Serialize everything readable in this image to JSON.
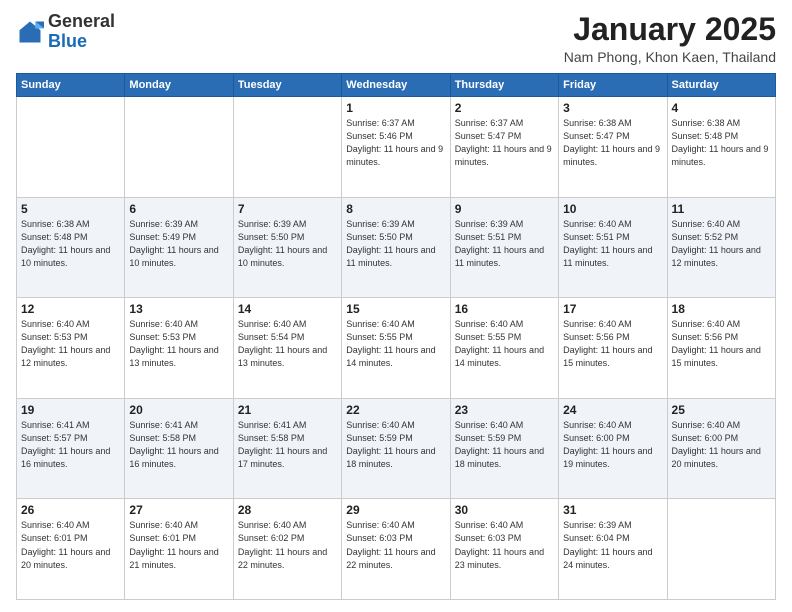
{
  "header": {
    "logo_general": "General",
    "logo_blue": "Blue",
    "month_title": "January 2025",
    "location": "Nam Phong, Khon Kaen, Thailand"
  },
  "days_of_week": [
    "Sunday",
    "Monday",
    "Tuesday",
    "Wednesday",
    "Thursday",
    "Friday",
    "Saturday"
  ],
  "weeks": [
    [
      {
        "day": "",
        "info": ""
      },
      {
        "day": "",
        "info": ""
      },
      {
        "day": "",
        "info": ""
      },
      {
        "day": "1",
        "info": "Sunrise: 6:37 AM\nSunset: 5:46 PM\nDaylight: 11 hours and 9 minutes."
      },
      {
        "day": "2",
        "info": "Sunrise: 6:37 AM\nSunset: 5:47 PM\nDaylight: 11 hours and 9 minutes."
      },
      {
        "day": "3",
        "info": "Sunrise: 6:38 AM\nSunset: 5:47 PM\nDaylight: 11 hours and 9 minutes."
      },
      {
        "day": "4",
        "info": "Sunrise: 6:38 AM\nSunset: 5:48 PM\nDaylight: 11 hours and 9 minutes."
      }
    ],
    [
      {
        "day": "5",
        "info": "Sunrise: 6:38 AM\nSunset: 5:48 PM\nDaylight: 11 hours and 10 minutes."
      },
      {
        "day": "6",
        "info": "Sunrise: 6:39 AM\nSunset: 5:49 PM\nDaylight: 11 hours and 10 minutes."
      },
      {
        "day": "7",
        "info": "Sunrise: 6:39 AM\nSunset: 5:50 PM\nDaylight: 11 hours and 10 minutes."
      },
      {
        "day": "8",
        "info": "Sunrise: 6:39 AM\nSunset: 5:50 PM\nDaylight: 11 hours and 11 minutes."
      },
      {
        "day": "9",
        "info": "Sunrise: 6:39 AM\nSunset: 5:51 PM\nDaylight: 11 hours and 11 minutes."
      },
      {
        "day": "10",
        "info": "Sunrise: 6:40 AM\nSunset: 5:51 PM\nDaylight: 11 hours and 11 minutes."
      },
      {
        "day": "11",
        "info": "Sunrise: 6:40 AM\nSunset: 5:52 PM\nDaylight: 11 hours and 12 minutes."
      }
    ],
    [
      {
        "day": "12",
        "info": "Sunrise: 6:40 AM\nSunset: 5:53 PM\nDaylight: 11 hours and 12 minutes."
      },
      {
        "day": "13",
        "info": "Sunrise: 6:40 AM\nSunset: 5:53 PM\nDaylight: 11 hours and 13 minutes."
      },
      {
        "day": "14",
        "info": "Sunrise: 6:40 AM\nSunset: 5:54 PM\nDaylight: 11 hours and 13 minutes."
      },
      {
        "day": "15",
        "info": "Sunrise: 6:40 AM\nSunset: 5:55 PM\nDaylight: 11 hours and 14 minutes."
      },
      {
        "day": "16",
        "info": "Sunrise: 6:40 AM\nSunset: 5:55 PM\nDaylight: 11 hours and 14 minutes."
      },
      {
        "day": "17",
        "info": "Sunrise: 6:40 AM\nSunset: 5:56 PM\nDaylight: 11 hours and 15 minutes."
      },
      {
        "day": "18",
        "info": "Sunrise: 6:40 AM\nSunset: 5:56 PM\nDaylight: 11 hours and 15 minutes."
      }
    ],
    [
      {
        "day": "19",
        "info": "Sunrise: 6:41 AM\nSunset: 5:57 PM\nDaylight: 11 hours and 16 minutes."
      },
      {
        "day": "20",
        "info": "Sunrise: 6:41 AM\nSunset: 5:58 PM\nDaylight: 11 hours and 16 minutes."
      },
      {
        "day": "21",
        "info": "Sunrise: 6:41 AM\nSunset: 5:58 PM\nDaylight: 11 hours and 17 minutes."
      },
      {
        "day": "22",
        "info": "Sunrise: 6:40 AM\nSunset: 5:59 PM\nDaylight: 11 hours and 18 minutes."
      },
      {
        "day": "23",
        "info": "Sunrise: 6:40 AM\nSunset: 5:59 PM\nDaylight: 11 hours and 18 minutes."
      },
      {
        "day": "24",
        "info": "Sunrise: 6:40 AM\nSunset: 6:00 PM\nDaylight: 11 hours and 19 minutes."
      },
      {
        "day": "25",
        "info": "Sunrise: 6:40 AM\nSunset: 6:00 PM\nDaylight: 11 hours and 20 minutes."
      }
    ],
    [
      {
        "day": "26",
        "info": "Sunrise: 6:40 AM\nSunset: 6:01 PM\nDaylight: 11 hours and 20 minutes."
      },
      {
        "day": "27",
        "info": "Sunrise: 6:40 AM\nSunset: 6:01 PM\nDaylight: 11 hours and 21 minutes."
      },
      {
        "day": "28",
        "info": "Sunrise: 6:40 AM\nSunset: 6:02 PM\nDaylight: 11 hours and 22 minutes."
      },
      {
        "day": "29",
        "info": "Sunrise: 6:40 AM\nSunset: 6:03 PM\nDaylight: 11 hours and 22 minutes."
      },
      {
        "day": "30",
        "info": "Sunrise: 6:40 AM\nSunset: 6:03 PM\nDaylight: 11 hours and 23 minutes."
      },
      {
        "day": "31",
        "info": "Sunrise: 6:39 AM\nSunset: 6:04 PM\nDaylight: 11 hours and 24 minutes."
      },
      {
        "day": "",
        "info": ""
      }
    ]
  ]
}
